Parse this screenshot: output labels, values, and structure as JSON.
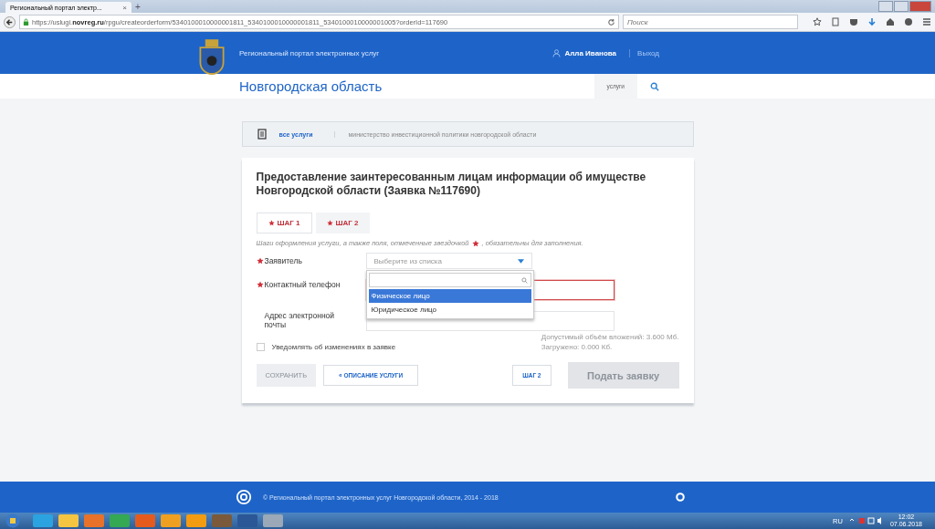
{
  "browser": {
    "tab_title": "Региональный портал электр...",
    "tab_close": "×",
    "new_tab": "+",
    "url_prefix": "https://uslugi.",
    "url_domain": "novreg.ru",
    "url_path": "/rpgu/createorderform/5340100010000001811_5340100010000001811_5340100010000001005?orderId=117690",
    "search_placeholder": "Поиск"
  },
  "header": {
    "portal_name": "Региональный портал электронных услуг",
    "user": "Алла Иванова",
    "logout": "Выход",
    "region": "Новгородская область",
    "nav_services": "услуги"
  },
  "breadcrumb": [
    {
      "label": "все услуги",
      "kind": "link"
    },
    {
      "label": "министерство инвестиционной политики новгородской области",
      "kind": "text"
    }
  ],
  "form": {
    "title": "Предоставление заинтересованным лицам информации об имуществе Новгородской области (Заявка №117690)",
    "steps": [
      {
        "label": "ШАГ 1",
        "selected": true
      },
      {
        "label": "ШАГ 2",
        "selected": false
      }
    ],
    "hint": "Шаги оформления услуги, а также поля, отмеченные звездочкой",
    "hint_end": ", обязательны для заполнения.",
    "fields": [
      {
        "label": "Заявитель",
        "required": true,
        "kind": "select",
        "placeholder": "Выберите из списка",
        "error": false
      },
      {
        "label": "Контактный телефон",
        "required": true,
        "kind": "text",
        "error": true
      },
      {
        "label": "Адрес электронной почты",
        "required": false,
        "kind": "text",
        "error": false
      }
    ],
    "dropdown": {
      "options": [
        {
          "label": "Физическое лицо",
          "selected": true
        },
        {
          "label": "Юридическое лицо",
          "selected": false
        }
      ]
    },
    "notify": {
      "label": "Уведомлять об изменениях в заявке",
      "checked": false
    },
    "limits": [
      "Допустимый объём вложений: 3.600 Мб.",
      "Загружено: 0.000 Кб."
    ],
    "buttons": {
      "save": {
        "label": "СОХРАНИТЬ",
        "disabled": true
      },
      "back": "« ОПИСАНИЕ УСЛУГИ",
      "next": "ШАГ 2",
      "submit": {
        "label": "Подать заявку",
        "disabled": true
      }
    }
  },
  "footer": {
    "copyright": "© Региональный портал электронных услуг Новгородской области, 2014 - 2018"
  },
  "taskbar": {
    "lang": "RU",
    "time": "12:02",
    "date": "07.06.2018"
  }
}
